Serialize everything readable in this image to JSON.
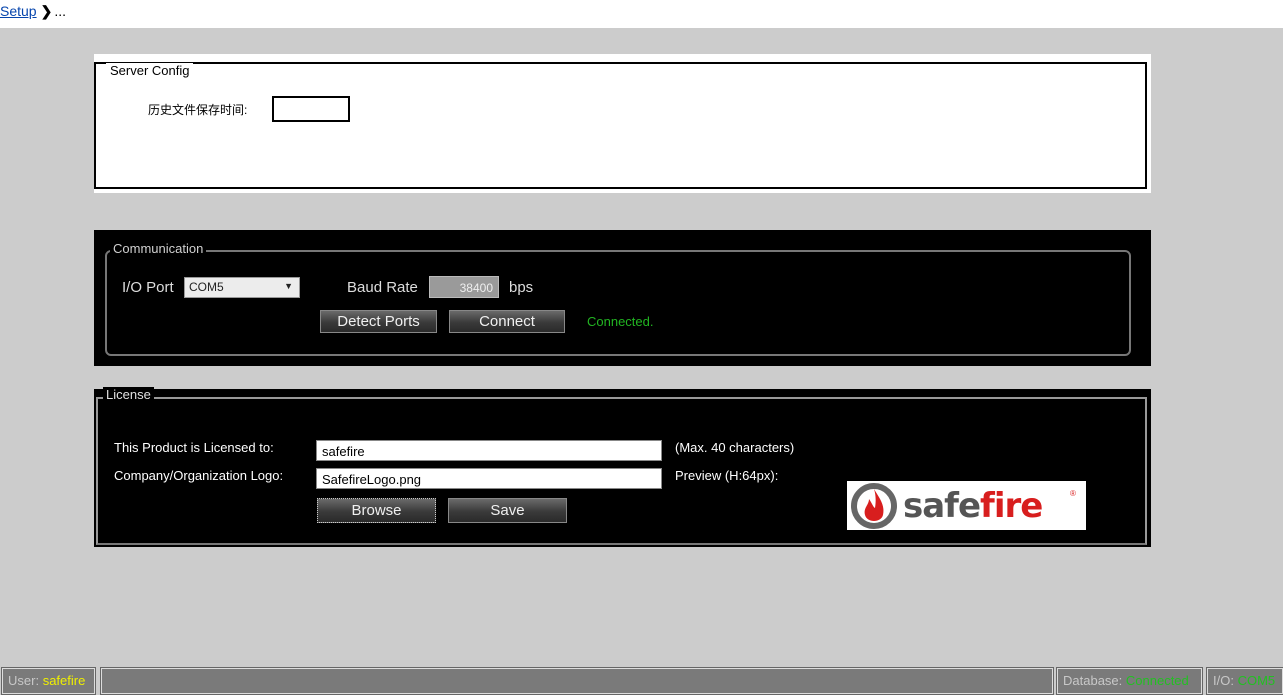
{
  "breadcrumb": {
    "root": "Setup",
    "separator": "❯",
    "current": "..."
  },
  "server_config": {
    "legend": "Server Config",
    "history_label": "历史文件保存时间:",
    "history_value": ""
  },
  "communication": {
    "legend": "Communication",
    "io_port_label": "I/O Port",
    "io_port_value": "COM5",
    "baud_label": "Baud Rate",
    "baud_value": "38400",
    "bps_label": "bps",
    "detect_button": "Detect Ports",
    "connect_button": "Connect",
    "status": "Connected."
  },
  "license": {
    "legend": "License",
    "licensed_to_label": "This Product is Licensed to:",
    "licensed_to_value": "safefire",
    "max_hint": "(Max. 40 characters)",
    "logo_label": "Company/Organization Logo:",
    "logo_value": "SafefireLogo.png",
    "preview_hint": "Preview (H:64px):",
    "browse_button": "Browse",
    "save_button": "Save",
    "logo_text_a": "safe",
    "logo_text_b": "fire",
    "logo_reg": "®"
  },
  "statusbar": {
    "user_label": "User:",
    "user_value": "safefire",
    "database_label": "Database:",
    "database_value": "Connected",
    "io_label": "I/O:",
    "io_value": "COM5"
  },
  "colors": {
    "status_green": "#22b422",
    "user_yellow": "#f0f000",
    "brand_red": "#d81e1e"
  }
}
